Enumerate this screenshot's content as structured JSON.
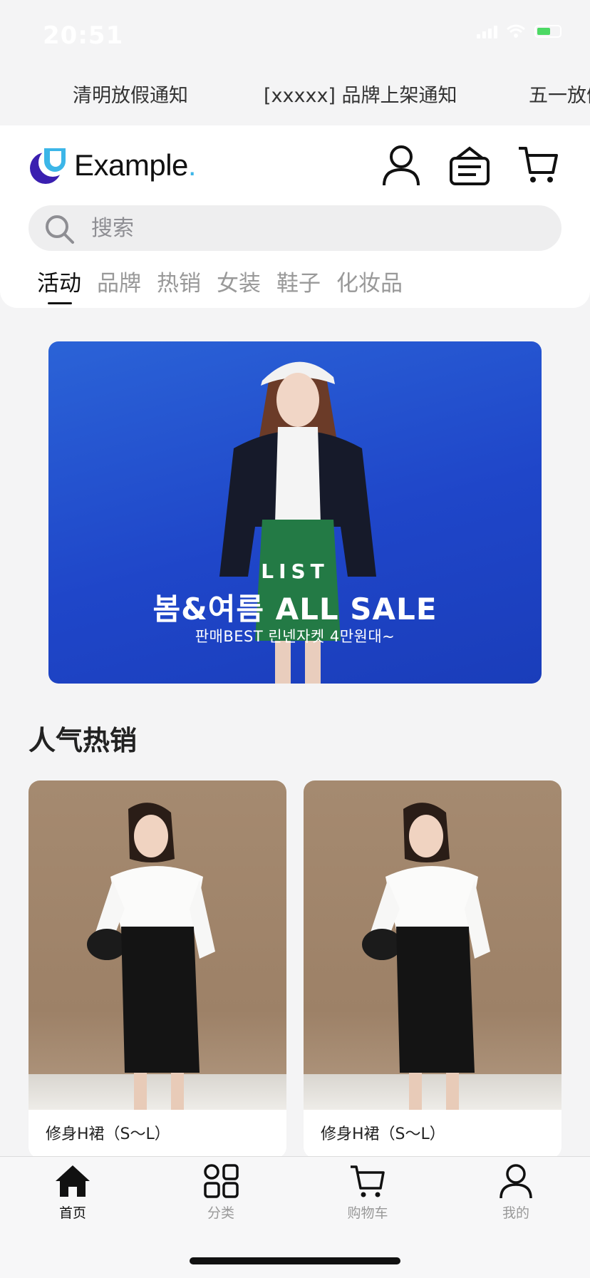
{
  "status_bar": {
    "time": "20:51"
  },
  "notices": [
    "清明放假通知",
    "[xxxxx] 品牌上架通知",
    "五一放假通知"
  ],
  "header": {
    "logo_text": "Example",
    "logo_dot": ".",
    "search_placeholder": "搜索",
    "icons": [
      "user-icon",
      "message-box-icon",
      "cart-icon"
    ]
  },
  "category_tabs": [
    {
      "label": "活动",
      "active": true
    },
    {
      "label": "品牌"
    },
    {
      "label": "热销"
    },
    {
      "label": "女装"
    },
    {
      "label": "鞋子"
    },
    {
      "label": "化妆品"
    }
  ],
  "banner": {
    "line1": "LIST",
    "line2": "봄&여름 ALL SALE",
    "line3": "판매BEST 린넨자켓 4만원대~",
    "background": "#2156d0"
  },
  "section": {
    "title": "人气热销"
  },
  "products": [
    {
      "name": "修身H裙（S～L）"
    },
    {
      "name": "修身H裙（S～L）"
    }
  ],
  "bottom_nav": [
    {
      "label": "首页",
      "icon": "home-icon",
      "active": true
    },
    {
      "label": "分类",
      "icon": "grid-icon"
    },
    {
      "label": "购物车",
      "icon": "cart-icon"
    },
    {
      "label": "我的",
      "icon": "user-icon"
    }
  ],
  "colors": {
    "accent": "#3cb6e8",
    "logo_purple": "#3a1fb0",
    "battery": "#4cd964"
  }
}
